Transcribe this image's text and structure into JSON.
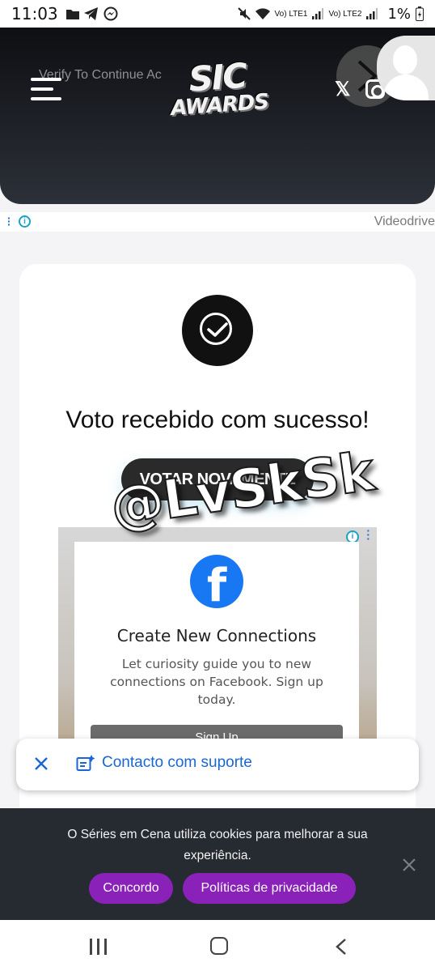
{
  "status_bar": {
    "time": "11:03",
    "network_labels": [
      "Vo) LTE1",
      "Vo) LTE2"
    ],
    "battery": "1%"
  },
  "header": {
    "ticker_text": "Verify To Continue Ac",
    "logo_line1": "SIC",
    "logo_line2": "AWARDS",
    "x_label": "𝕏"
  },
  "ad_strip": {
    "info_glyph": "i",
    "provider": "Videodrive"
  },
  "card": {
    "title": "Voto recebido com sucesso!",
    "vote_again_label": "VOTAR NOVAMENTE"
  },
  "fb_ad": {
    "info_glyph": "i",
    "logo_glyph": "f",
    "title": "Create New Connections",
    "description": "Let curiosity guide you to new connections on Facebook. Sign up today.",
    "cta_label": "Sign Up"
  },
  "watermark": "@LvSkSk",
  "support": {
    "label": "Contacto com suporte"
  },
  "cookie": {
    "text": "O Séries em Cena utiliza cookies para melhorar a sua experiência.",
    "agree_label": "Concordo",
    "privacy_label": "Políticas de privacidade"
  },
  "colors": {
    "accent_purple": "#8a21b9",
    "support_blue": "#1a66d6",
    "facebook_blue": "#1877f2"
  }
}
